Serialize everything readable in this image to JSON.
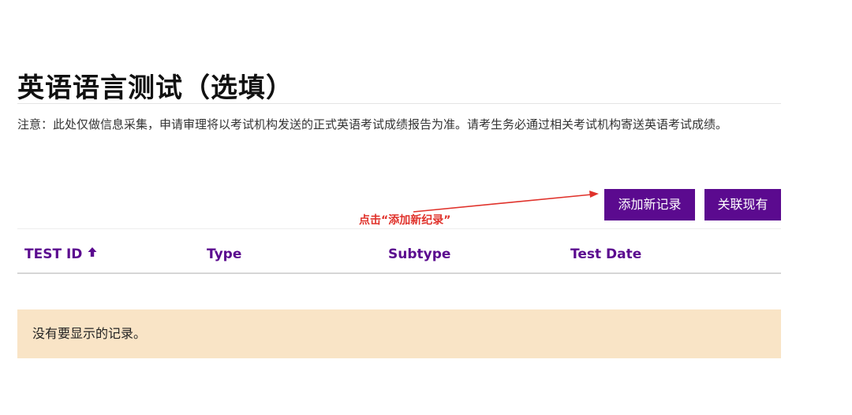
{
  "page": {
    "title": "英语语言测试（选填）",
    "notice": "注意：此处仅做信息采集，申请审理将以考试机构发送的正式英语考试成绩报告为准。请考生务必通过相关考试机构寄送英语考试成绩。"
  },
  "toolbar": {
    "add_label": "添加新记录",
    "link_label": "关联现有"
  },
  "annotation": {
    "label": "点击“添加新纪录”"
  },
  "table": {
    "columns": [
      {
        "label": "TEST ID",
        "sort": "ascending",
        "sort_icon": "arrow-up-icon"
      },
      {
        "label": "Type"
      },
      {
        "label": "Subtype"
      },
      {
        "label": "Test Date"
      }
    ],
    "empty_message": "没有要显示的记录。"
  },
  "colors": {
    "brand_purple": "#5b0a8f",
    "annotation_red": "#e0322b",
    "empty_bg": "#f9e4c6",
    "text": "#222222"
  }
}
